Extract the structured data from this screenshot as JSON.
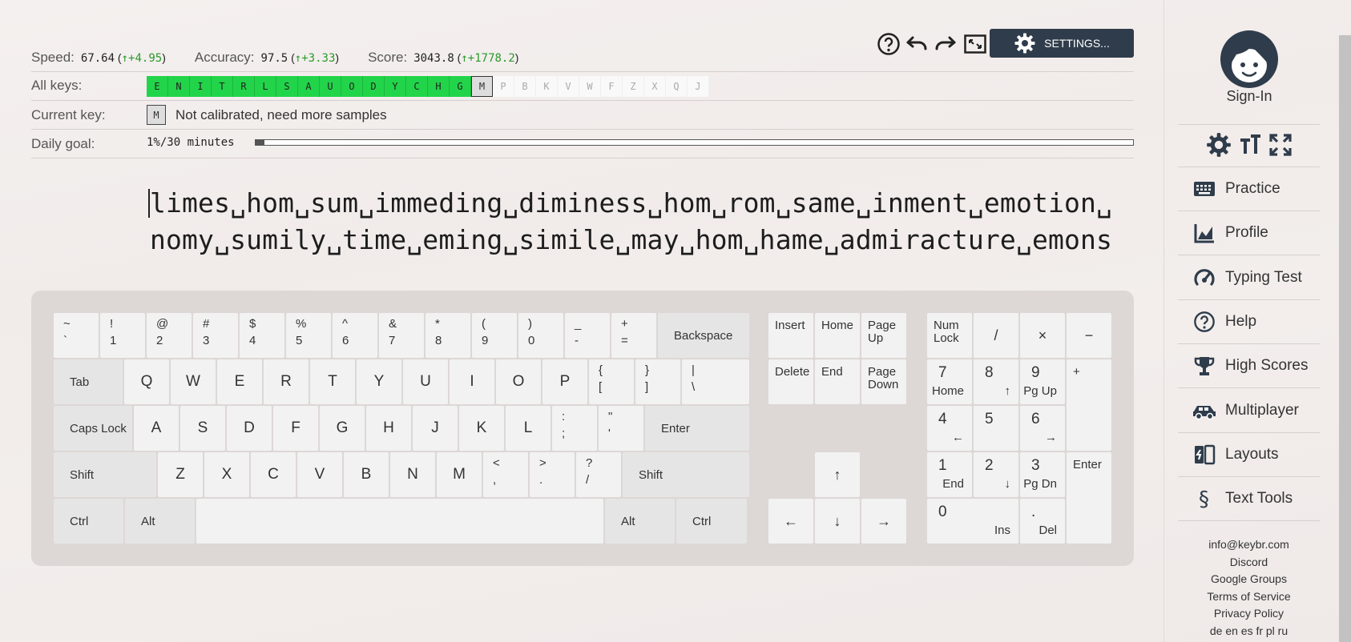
{
  "stats": {
    "speed": {
      "label": "Speed:",
      "value": "67.64",
      "delta": "+4.95"
    },
    "accuracy": {
      "label": "Accuracy:",
      "value": "97.5",
      "delta": "+3.33"
    },
    "score": {
      "label": "Score:",
      "value": "3043.8",
      "delta": "+1778.2"
    }
  },
  "all_keys": {
    "label": "All keys:",
    "done": [
      "E",
      "N",
      "I",
      "T",
      "R",
      "L",
      "S",
      "A",
      "U",
      "O",
      "D",
      "Y",
      "C",
      "H",
      "G"
    ],
    "current": "M",
    "todo": [
      "P",
      "B",
      "K",
      "V",
      "W",
      "F",
      "Z",
      "X",
      "Q",
      "J"
    ]
  },
  "current_key": {
    "label": "Current key:",
    "key": "M",
    "message": "Not calibrated, need more samples"
  },
  "daily_goal": {
    "label": "Daily goal:",
    "text": "1%/30 minutes",
    "progress": 0.01
  },
  "toolbar": {
    "settings_label": "SETTINGS..."
  },
  "lesson": {
    "line1": "limes␣hom␣sum␣immeding␣diminess␣hom␣rom␣same␣inment␣emotion␣",
    "line2": "nomy␣sumily␣time␣eming␣simile␣may␣hom␣hame␣admiracture␣emons"
  },
  "keyboard": {
    "number_row": [
      [
        "~",
        "`"
      ],
      [
        "!",
        "1"
      ],
      [
        "@",
        "2"
      ],
      [
        "#",
        "3"
      ],
      [
        "$",
        "4"
      ],
      [
        "%",
        "5"
      ],
      [
        "^",
        "6"
      ],
      [
        "&",
        "7"
      ],
      [
        "*",
        "8"
      ],
      [
        "(",
        "9"
      ],
      [
        ")",
        "0"
      ],
      [
        "_",
        "-"
      ],
      [
        "+",
        "="
      ]
    ],
    "backspace": "Backspace",
    "tab": "Tab",
    "q_row": [
      "Q",
      "W",
      "E",
      "R",
      "T",
      "Y",
      "U",
      "I",
      "O",
      "P"
    ],
    "q_row_sym": [
      [
        "{",
        "["
      ],
      [
        "}",
        "]"
      ],
      [
        "|",
        "\\"
      ]
    ],
    "caps": "Caps Lock",
    "a_row": [
      "A",
      "S",
      "D",
      "F",
      "G",
      "H",
      "J",
      "K",
      "L"
    ],
    "a_row_sym": [
      [
        ":",
        ";"
      ],
      [
        "\"",
        "'"
      ]
    ],
    "enter": "Enter",
    "shift": "Shift",
    "z_row": [
      "Z",
      "X",
      "C",
      "V",
      "B",
      "N",
      "M"
    ],
    "z_row_sym": [
      [
        "<",
        ","
      ],
      [
        ">",
        "."
      ],
      [
        "?",
        "/"
      ]
    ],
    "ctrl": "Ctrl",
    "alt": "Alt",
    "nav": {
      "insert": "Insert",
      "home": "Home",
      "page_up": "Page Up",
      "delete": "Delete",
      "end": "End",
      "page_down": "Page Down",
      "up": "↑",
      "left": "←",
      "down": "↓",
      "right": "→"
    },
    "numpad": {
      "num_lock": "Num Lock",
      "divide": "/",
      "multiply": "×",
      "minus": "−",
      "plus": "+",
      "enter": "Enter",
      "n7": [
        "7",
        "Home"
      ],
      "n8": [
        "8",
        "↑"
      ],
      "n9": [
        "9",
        "Pg Up"
      ],
      "n4": [
        "4",
        "←"
      ],
      "n5": [
        "5",
        ""
      ],
      "n6": [
        "6",
        "→"
      ],
      "n1": [
        "1",
        "End"
      ],
      "n2": [
        "2",
        "↓"
      ],
      "n3": [
        "3",
        "Pg Dn"
      ],
      "n0": [
        "0",
        "Ins"
      ],
      "dot": [
        ".",
        "Del"
      ]
    }
  },
  "sidebar": {
    "sign_in": "Sign-In",
    "nav": [
      {
        "label": "Practice",
        "icon": "keyboard-icon"
      },
      {
        "label": "Profile",
        "icon": "chart-icon"
      },
      {
        "label": "Typing Test",
        "icon": "speedometer-icon"
      },
      {
        "label": "Help",
        "icon": "help-icon"
      },
      {
        "label": "High Scores",
        "icon": "trophy-icon"
      },
      {
        "label": "Multiplayer",
        "icon": "car-icon"
      },
      {
        "label": "Layouts",
        "icon": "layouts-icon"
      },
      {
        "label": "Text Tools",
        "icon": "section-icon"
      }
    ],
    "footer": {
      "email": "info@keybr.com",
      "discord": "Discord",
      "groups": "Google Groups",
      "terms": "Terms of Service",
      "privacy": "Privacy Policy",
      "languages": "de en es fr pl ru"
    }
  },
  "colors": {
    "accent_green": "#22d44a",
    "settings_bg": "#2f3c4b",
    "delta_green": "#2a9a2a"
  }
}
